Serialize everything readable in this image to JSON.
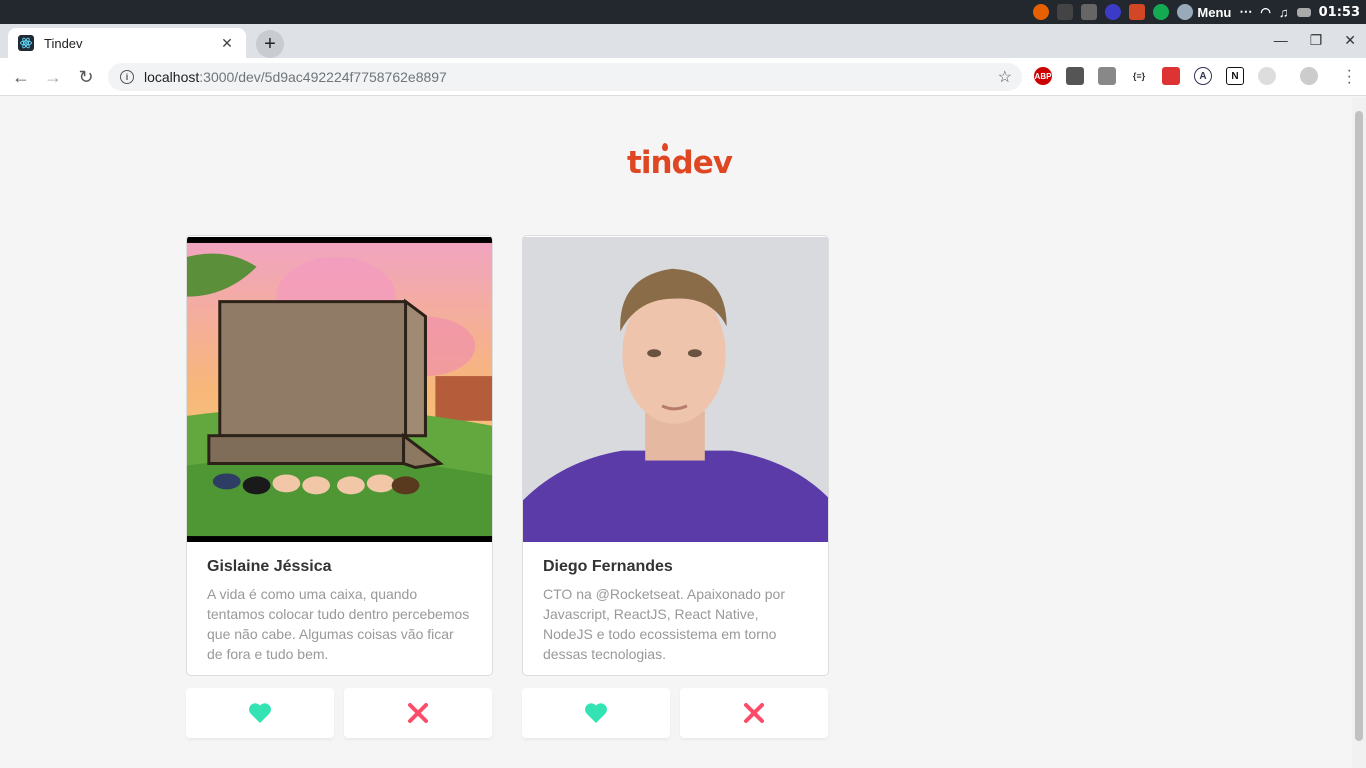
{
  "os": {
    "menu_label": "Menu",
    "clock": "01:53"
  },
  "browser": {
    "tab_title": "Tindev",
    "url_host": "localhost",
    "url_rest": ":3000/dev/5d9ac492224f7758762e8897"
  },
  "page": {
    "logo": "tindev",
    "devs": [
      {
        "name": "Gislaine Jéssica",
        "bio": "A vida é como uma caixa, quando tentamos colocar tudo dentro percebemos que não cabe. Algumas coisas vão ficar de fora e tudo bem."
      },
      {
        "name": "Diego Fernandes",
        "bio": "CTO na @Rocketseat. Apaixonado por Javascript, ReactJS, React Native, NodeJS e todo ecossistema em torno dessas tecnologias."
      }
    ]
  },
  "colors": {
    "like": "#33e3b3",
    "dislike": "#fc4c6a",
    "brand": "#df4723"
  }
}
